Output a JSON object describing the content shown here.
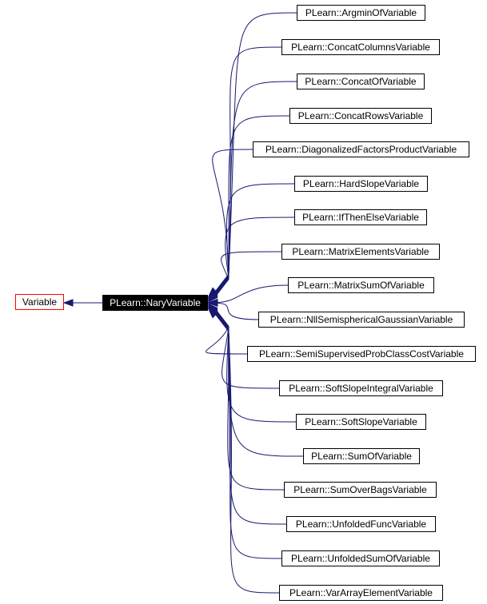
{
  "diagram": {
    "type": "inheritance-graph",
    "base": {
      "label": "Variable",
      "border_color": "#ff0000"
    },
    "focus": {
      "label": "PLearn::NaryVariable",
      "fill_color": "#000000",
      "text_color": "#ffffff"
    },
    "edge_color": "#191970",
    "children": [
      {
        "label": "PLearn::ArgminOfVariable"
      },
      {
        "label": "PLearn::ConcatColumnsVariable"
      },
      {
        "label": "PLearn::ConcatOfVariable"
      },
      {
        "label": "PLearn::ConcatRowsVariable"
      },
      {
        "label": "PLearn::DiagonalizedFactorsProductVariable"
      },
      {
        "label": "PLearn::HardSlopeVariable"
      },
      {
        "label": "PLearn::IfThenElseVariable"
      },
      {
        "label": "PLearn::MatrixElementsVariable"
      },
      {
        "label": "PLearn::MatrixSumOfVariable"
      },
      {
        "label": "PLearn::NllSemisphericalGaussianVariable"
      },
      {
        "label": "PLearn::SemiSupervisedProbClassCostVariable"
      },
      {
        "label": "PLearn::SoftSlopeIntegralVariable"
      },
      {
        "label": "PLearn::SoftSlopeVariable"
      },
      {
        "label": "PLearn::SumOfVariable"
      },
      {
        "label": "PLearn::SumOverBagsVariable"
      },
      {
        "label": "PLearn::UnfoldedFuncVariable"
      },
      {
        "label": "PLearn::UnfoldedSumOfVariable"
      },
      {
        "label": "PLearn::VarArrayElementVariable"
      }
    ]
  }
}
